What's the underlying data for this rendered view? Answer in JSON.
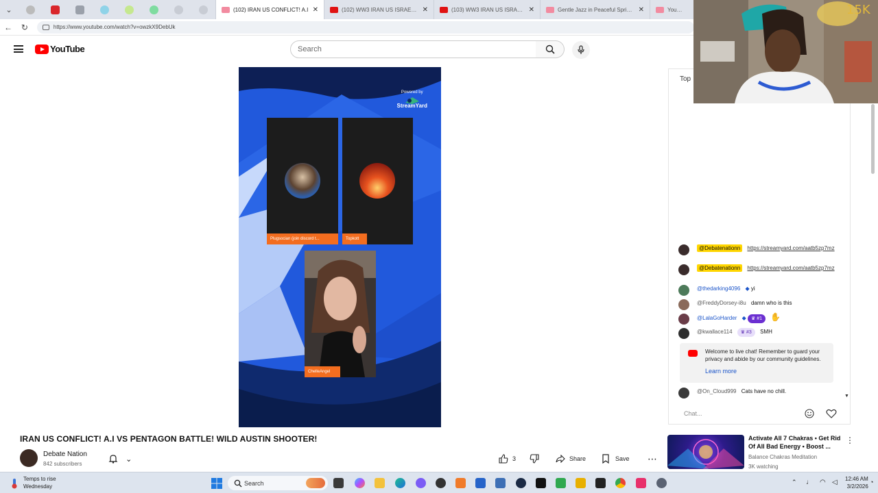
{
  "browser": {
    "tabs": [
      {
        "title": "(102) IRAN US CONFLICT! A.I",
        "active": true
      },
      {
        "title": "(102) WW3 IRAN US ISRAEL | The",
        "active": false
      },
      {
        "title": "(103) WW3 IRAN US ISRAEL | The",
        "active": false
      },
      {
        "title": "Gentle Jazz in Peaceful Spring for",
        "active": false
      },
      {
        "title": "YouTube",
        "active": false
      }
    ],
    "url": "https://www.youtube.com/watch?v=owzkX9DebUk"
  },
  "header": {
    "logo_text": "YouTube",
    "search_placeholder": "Search"
  },
  "video": {
    "powered_by": "Powered by",
    "brand": "StreamYard",
    "participants": [
      "Plugsocian (join discord t...",
      "Topkott",
      "ChelleAngel"
    ]
  },
  "title": "IRAN US CONFLICT! A.I VS PENTAGON BATTLE! WILD AUSTIN SHOOTER!",
  "channel": {
    "name": "Debate Nation",
    "subscribers": "842 subscribers"
  },
  "actions": {
    "likes": "3",
    "share": "Share",
    "save": "Save"
  },
  "chat": {
    "top_label": "Top",
    "messages": [
      {
        "author": "@Debatenationn",
        "text": "https://streamyard.com/aatb5zp7mz",
        "style": "highlight"
      },
      {
        "author": "@Debatenationn",
        "text": "https://streamyard.com/aatb5zp7mz",
        "style": "highlight"
      },
      {
        "author": "@thedarking4096",
        "text": "yi",
        "style": "member"
      },
      {
        "author": "@FreddyDorsey-i8u",
        "text": "damn who is this",
        "style": "normal"
      },
      {
        "author": "@LalaGoHarder",
        "badge": "#1",
        "style": "member"
      },
      {
        "author": "@kwallace114",
        "badge": "#3",
        "text": "SMH",
        "style": "normal"
      },
      {
        "author": "@On_Cloud999",
        "text": "Cats have no chill.",
        "style": "normal"
      }
    ],
    "welcome_text": "Welcome to live chat! Remember to guard your privacy and abide by our community guidelines.",
    "learn_more": "Learn more",
    "input_placeholder": "Chat..."
  },
  "recommendation": {
    "title": "Activate All 7 Chakras • Get Rid Of All Bad Energy • Boost ...",
    "channel": "Balance Chakras Meditation",
    "views": "3K watching"
  },
  "taskbar": {
    "weather_line1": "Temps to rise",
    "weather_line2": "Wednesday",
    "search": "Search",
    "time": "12:46 AM",
    "date": "3/2/2026"
  }
}
